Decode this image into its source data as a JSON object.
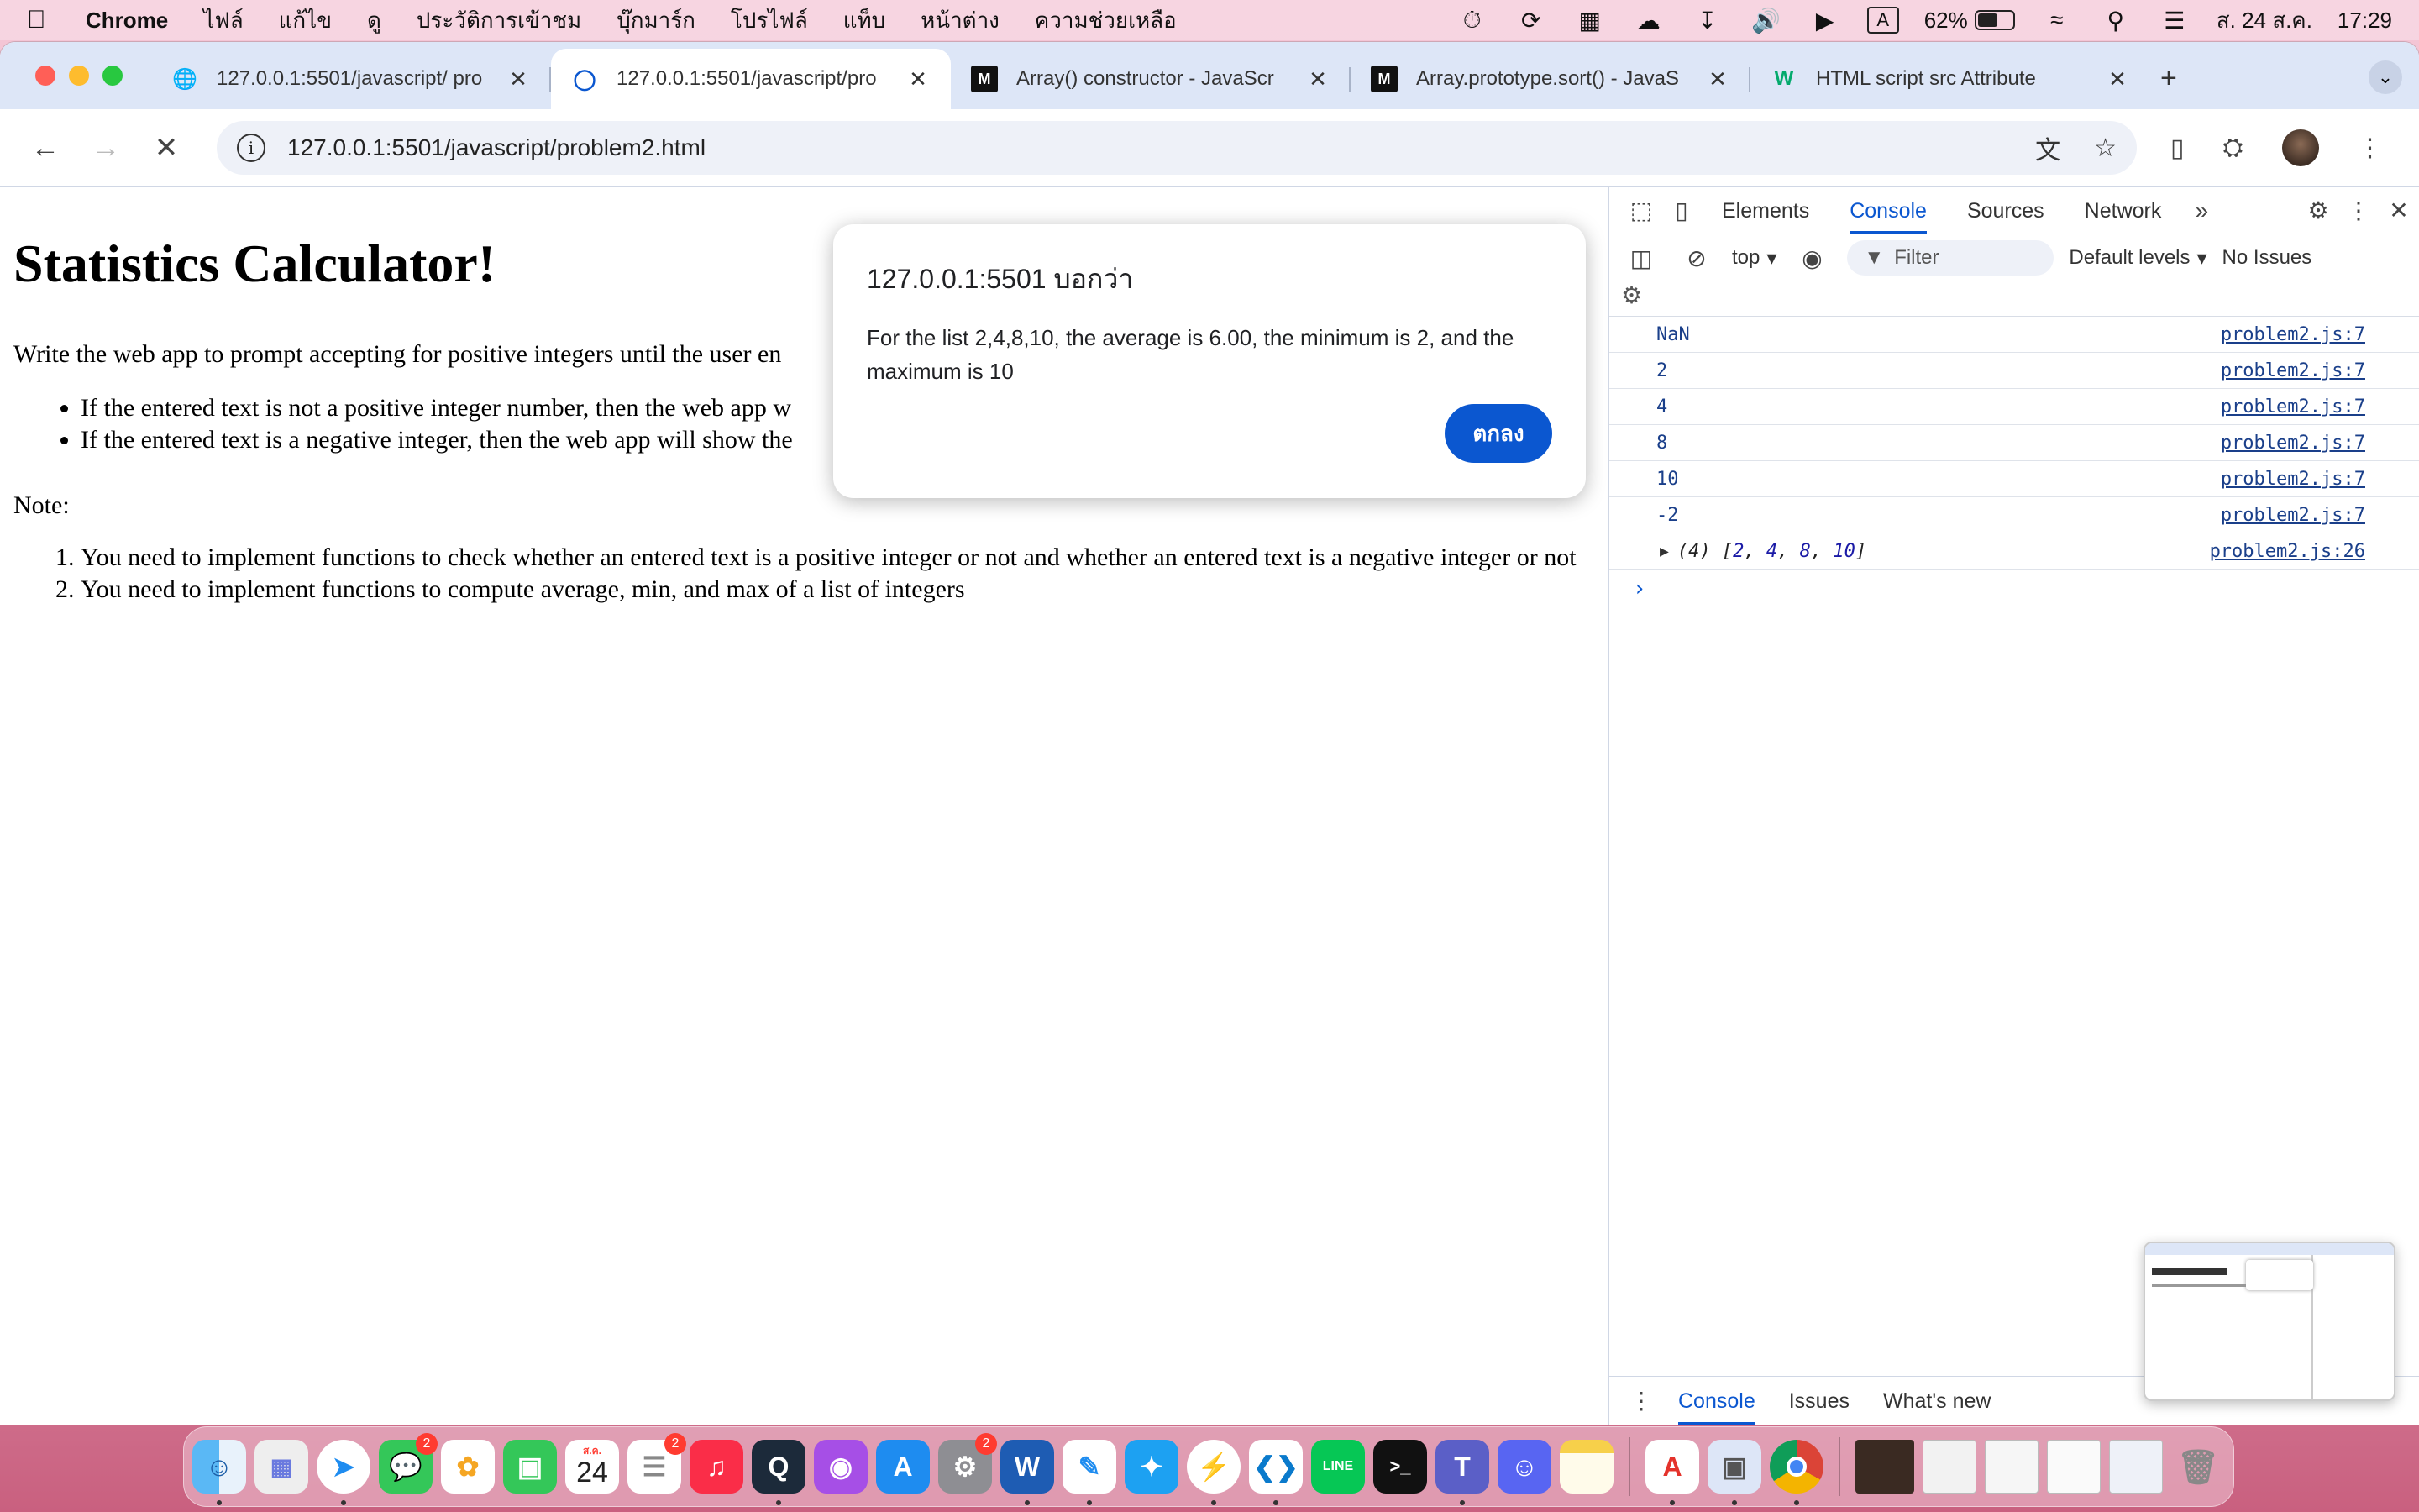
{
  "menubar": {
    "app_name": "Chrome",
    "items": [
      "ไฟล์",
      "แก้ไข",
      "ดู",
      "ประวัติการเข้าชม",
      "บุ๊กมาร์ก",
      "โปรไฟล์",
      "แท็บ",
      "หน้าต่าง",
      "ความช่วยเหลือ"
    ],
    "input_source": "A",
    "battery_percent": "62%",
    "battery_level": 0.62,
    "date": "ส. 24 ส.ค.",
    "time": "17:29"
  },
  "tabs": [
    {
      "title": "127.0.0.1:5501/javascript/ pro",
      "icon": "globe-icon",
      "active": false
    },
    {
      "title": "127.0.0.1:5501/javascript/pro",
      "icon": "loading-icon",
      "active": true
    },
    {
      "title": "Array() constructor - JavaScr",
      "icon": "mdn-icon",
      "active": false
    },
    {
      "title": "Array.prototype.sort() - JavaS",
      "icon": "mdn-icon",
      "active": false
    },
    {
      "title": "HTML script src Attribute",
      "icon": "w3schools-icon",
      "active": false
    }
  ],
  "toolbar": {
    "url": "127.0.0.1:5501/javascript/problem2.html"
  },
  "page": {
    "title": "Statistics Calculator!",
    "intro": "Write the web app to prompt accepting for positive integers until the user en",
    "bullets": [
      "If the entered text is not a positive integer number, then the web app w",
      "If the entered text is a negative integer, then the web app will show the"
    ],
    "note_label": "Note:",
    "notes": [
      "You need to implement functions to check whether an entered text is a positive integer or not and whether an entered text is a negative integer or not",
      "You need to implement functions to compute average, min, and max of a list of integers"
    ]
  },
  "alert": {
    "origin": "127.0.0.1:5501 บอกว่า",
    "message": "For the list 2,4,8,10, the average is 6.00, the minimum is 2, and the maximum is 10",
    "ok_label": "ตกลง"
  },
  "devtools": {
    "tabs": [
      "Elements",
      "Console",
      "Sources",
      "Network"
    ],
    "active_tab": "Console",
    "context": "top",
    "filter_placeholder": "Filter",
    "levels": "Default levels",
    "issues": "No Issues",
    "console": [
      {
        "value": "NaN",
        "source": "problem2.js:7"
      },
      {
        "value": "2",
        "source": "problem2.js:7"
      },
      {
        "value": "4",
        "source": "problem2.js:7"
      },
      {
        "value": "8",
        "source": "problem2.js:7"
      },
      {
        "value": "10",
        "source": "problem2.js:7"
      },
      {
        "value": "-2",
        "source": "problem2.js:7"
      }
    ],
    "array_log": {
      "prefix": "(4) [",
      "items": [
        "2",
        "4",
        "8",
        "10"
      ],
      "suffix": "]",
      "source": "problem2.js:26"
    },
    "drawer_tabs": [
      "Console",
      "Issues",
      "What's new"
    ]
  },
  "dock": {
    "calendar_month": "ส.ค.",
    "calendar_day": "24",
    "messages_badge": "2",
    "reminders_badge": "2",
    "settings_badge": "2"
  }
}
